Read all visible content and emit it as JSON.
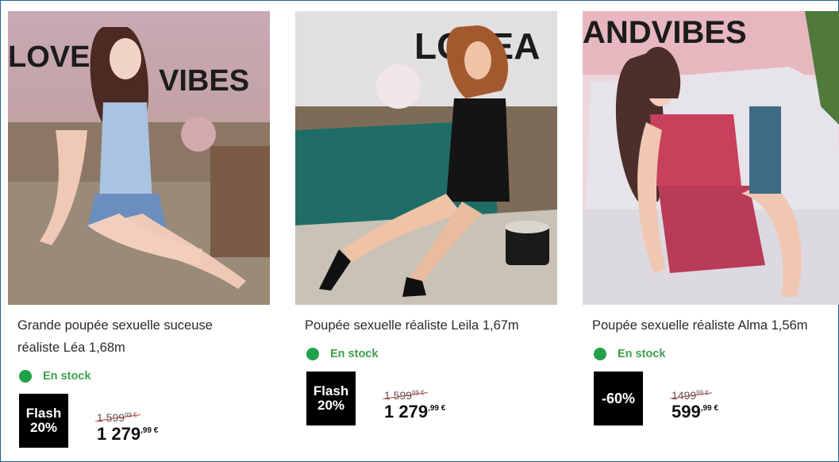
{
  "products": [
    {
      "title": "Grande poupée sexuelle suceuse réaliste Léa 1,68m",
      "stock": "En stock",
      "badge_line1": "Flash",
      "badge_line2": "20%",
      "old_price": "1 599",
      "old_cents": "99 €",
      "new_price": "1 279",
      "new_cents": ",99 €",
      "photo_text": "LOVE VIBES"
    },
    {
      "title": "Poupée sexuelle réaliste Leila 1,67m",
      "stock": "En stock",
      "badge_line1": "Flash",
      "badge_line2": "20%",
      "old_price": "1 599",
      "old_cents": "99 €",
      "new_price": "1 279",
      "new_cents": ",99 €",
      "photo_text": "LOVEA"
    },
    {
      "title": "Poupée sexuelle réaliste Alma 1,56m",
      "stock": "En stock",
      "badge_line1": "-60%",
      "badge_line2": "",
      "old_price": "1499",
      "old_cents": "99 €",
      "new_price": "599",
      "new_cents": ",99 €",
      "photo_text": "ANDVIBES"
    }
  ],
  "colors": {
    "stock_green": "#21a04a",
    "frame_blue": "#1f5f8b",
    "badge_bg": "#000000"
  }
}
